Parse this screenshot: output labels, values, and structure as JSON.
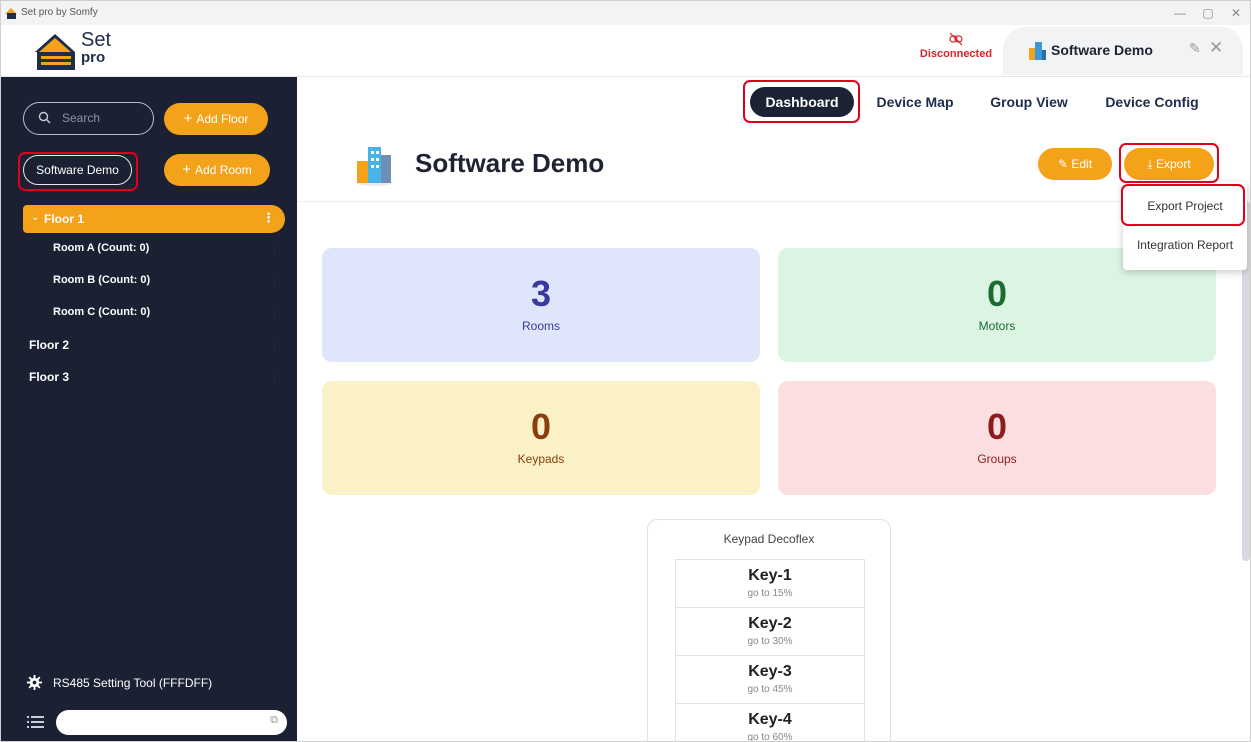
{
  "window": {
    "title": "Set pro by Somfy",
    "min": "—",
    "max": "▢",
    "close": "✕"
  },
  "header": {
    "logo_set": "Set",
    "logo_pro": "pro",
    "status": "Disconnected",
    "project_tab": "Software Demo"
  },
  "sidebar": {
    "search_placeholder": "Search",
    "add_floor": "Add Floor",
    "project_chip": "Software Demo",
    "add_room": "Add Room",
    "floors": [
      {
        "label": "Floor 1",
        "expanded": true,
        "rooms": [
          "Room A (Count: 0)",
          "Room B (Count: 0)",
          "Room C (Count: 0)"
        ]
      },
      {
        "label": "Floor 2"
      },
      {
        "label": "Floor 3"
      }
    ],
    "rs485": "RS485 Setting Tool (FFFDFF)"
  },
  "nav": {
    "tabs": [
      "Dashboard",
      "Device Map",
      "Group View",
      "Device Config"
    ],
    "active": "Dashboard"
  },
  "main": {
    "title": "Software Demo",
    "edit": "Edit",
    "export": "Export",
    "export_menu": [
      "Export Project",
      "Integration Report"
    ],
    "stats": [
      {
        "value": "3",
        "label": "Rooms",
        "bg": "#dfe5fb",
        "color": "#3a3a9e"
      },
      {
        "value": "0",
        "label": "Motors",
        "bg": "#dcf5e3",
        "color": "#1d6b33"
      },
      {
        "value": "0",
        "label": "Keypads",
        "bg": "#fbf1c7",
        "color": "#8a3d0d"
      },
      {
        "value": "0",
        "label": "Groups",
        "bg": "#fbdfe0",
        "color": "#8c1c1c"
      }
    ],
    "keypad": {
      "title": "Keypad Decoflex",
      "keys": [
        {
          "name": "Key-1",
          "action": "go to 15%"
        },
        {
          "name": "Key-2",
          "action": "go to 30%"
        },
        {
          "name": "Key-3",
          "action": "go to 45%"
        },
        {
          "name": "Key-4",
          "action": "go to 60%"
        }
      ]
    }
  },
  "colors": {
    "accent": "#f5a21b",
    "sidebar": "#1b2133",
    "highlight": "#e0001b",
    "status": "#d9222a"
  }
}
